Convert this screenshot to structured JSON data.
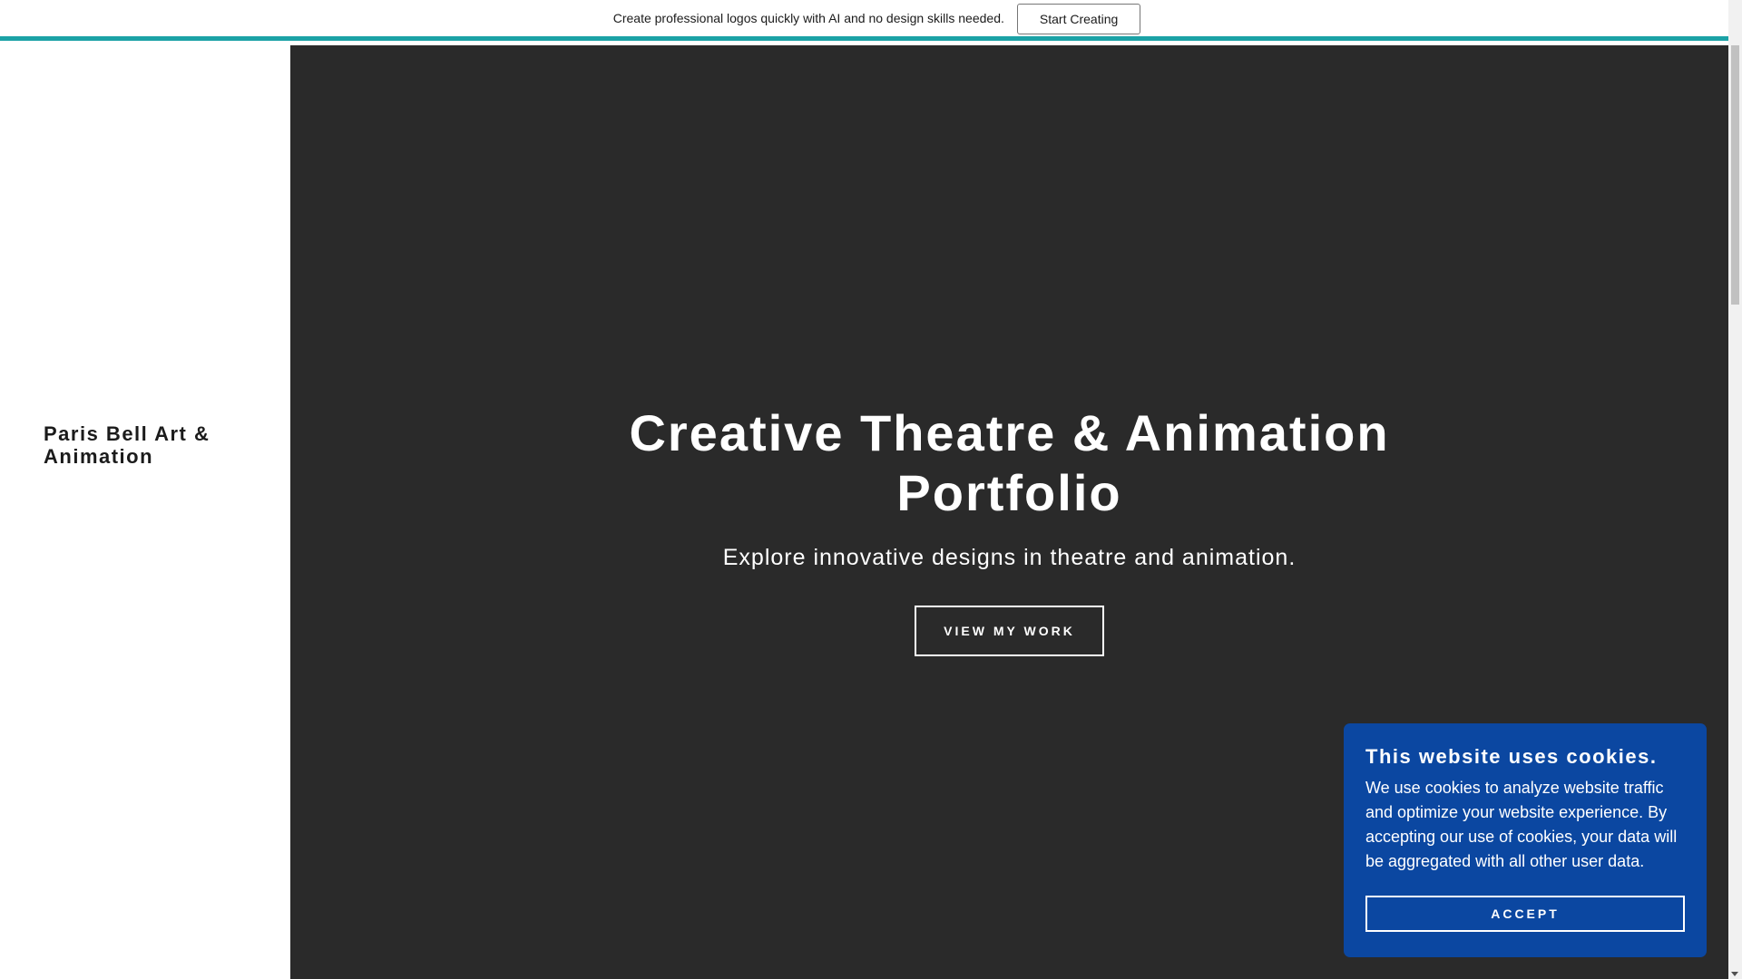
{
  "promo": {
    "text": "Create professional logos quickly with AI and no design skills needed.",
    "button_label": "Start Creating",
    "accent_color": "#1ba2a6"
  },
  "sidebar": {
    "site_title": "Paris Bell Art & Animation"
  },
  "hero": {
    "title": "Creative Theatre & Animation Portfolio",
    "subtitle": "Explore innovative designs in theatre and animation.",
    "button_label": "VIEW MY WORK",
    "background_color": "#2a2a2a"
  },
  "cookie_banner": {
    "title": "This website uses cookies.",
    "text": "We use cookies to analyze website traffic and optimize your website experience. By accepting our use of cookies, your data will be aggregated with all other user data.",
    "accept_label": "ACCEPT",
    "background_color": "#0b47a1"
  },
  "icons": {
    "scroll_down": "chevron-down-icon"
  }
}
